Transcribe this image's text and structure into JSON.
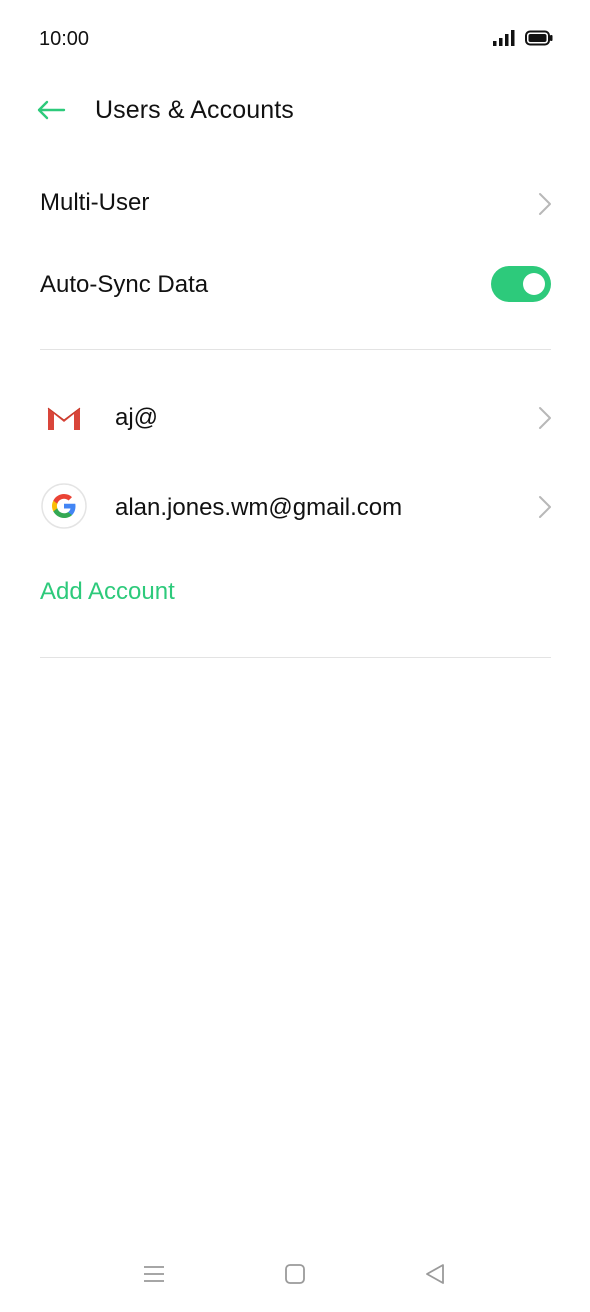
{
  "status_bar": {
    "time": "10:00",
    "icons": [
      "signal-icon",
      "battery-icon"
    ]
  },
  "header": {
    "back_icon": "arrow-left-icon",
    "title": "Users & Accounts"
  },
  "settings": {
    "multi_user": {
      "label": "Multi-User",
      "icon": "chevron-right-icon"
    },
    "auto_sync": {
      "label": "Auto-Sync Data",
      "toggle_on": true
    }
  },
  "accounts": [
    {
      "icon": "gmail-icon",
      "label": "aj@"
    },
    {
      "icon": "google-icon",
      "label": "alan.jones.wm@gmail.com"
    }
  ],
  "add_account_label": "Add Account",
  "colors": {
    "accent": "#2dca7b",
    "text": "#111111",
    "divider": "#e3e3e3",
    "chevron": "#b8b8b8"
  },
  "nav_bar": {
    "icons": [
      "menu-icon",
      "home-icon",
      "back-triangle-icon"
    ]
  }
}
